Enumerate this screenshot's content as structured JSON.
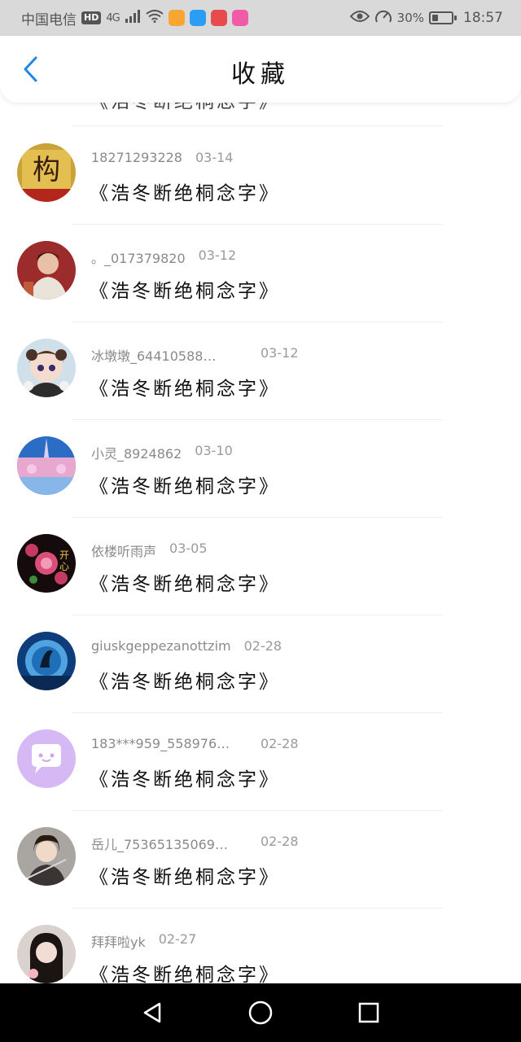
{
  "status_bar": {
    "carrier": "中国电信",
    "hd_badge": "HD",
    "network": "4G",
    "battery": "30%",
    "battery_level": 0.3,
    "time": "18:57"
  },
  "header": {
    "title": "收藏"
  },
  "partial_top_item": {
    "text": "《浩冬断绝桐念字》"
  },
  "items": [
    {
      "user": "18271293228",
      "date": "03-14",
      "text": "《浩冬断绝桐念字》"
    },
    {
      "user": "。_017379820",
      "date": "03-12",
      "text": "《浩冬断绝桐念字》"
    },
    {
      "user": "冰墩墩_64410588…",
      "date": "03-12",
      "text": "《浩冬断绝桐念字》"
    },
    {
      "user": "小灵_8924862",
      "date": "03-10",
      "text": "《浩冬断绝桐念字》"
    },
    {
      "user": "依楼听雨声",
      "date": "03-05",
      "text": "《浩冬断绝桐念字》"
    },
    {
      "user": "giuskgeppezanottzim",
      "date": "02-28",
      "text": "《浩冬断绝桐念字》"
    },
    {
      "user": "183***959_558976…",
      "date": "02-28",
      "text": "《浩冬断绝桐念字》"
    },
    {
      "user": "岳儿_75365135069…",
      "date": "02-28",
      "text": "《浩冬断绝桐念字》"
    },
    {
      "user": "拜拜啦yk",
      "date": "02-27",
      "text": "《浩冬断绝桐念字》"
    }
  ],
  "colors": {
    "accent": "#1e88e5",
    "status_bar_bg": "#d9d9d9",
    "nav_bar_bg": "#000000"
  },
  "icons": {
    "back": "chevron-left-icon",
    "nav_back": "triangle-back-icon",
    "nav_home": "circle-home-icon",
    "nav_recent": "square-recent-icon"
  }
}
